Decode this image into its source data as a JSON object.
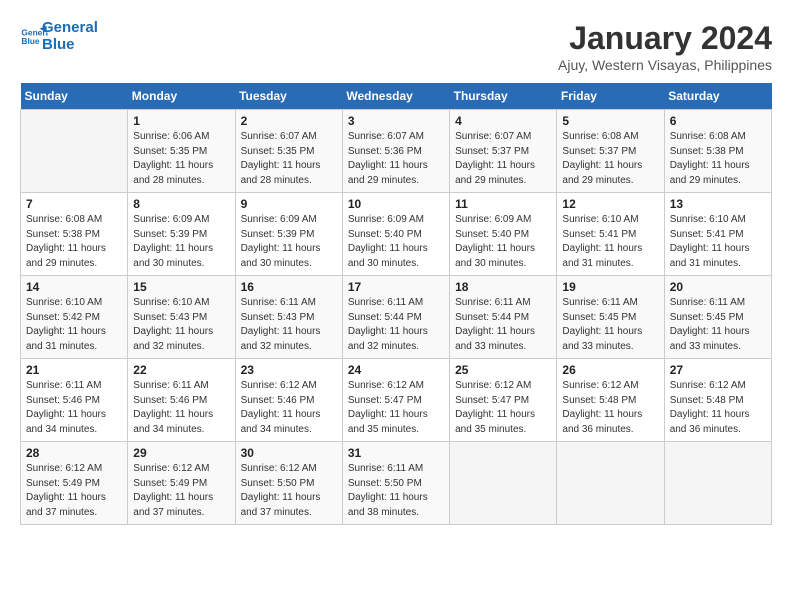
{
  "logo": {
    "line1": "General",
    "line2": "Blue"
  },
  "title": "January 2024",
  "subtitle": "Ajuy, Western Visayas, Philippines",
  "days_header": [
    "Sunday",
    "Monday",
    "Tuesday",
    "Wednesday",
    "Thursday",
    "Friday",
    "Saturday"
  ],
  "weeks": [
    [
      {
        "num": "",
        "info": ""
      },
      {
        "num": "1",
        "info": "Sunrise: 6:06 AM\nSunset: 5:35 PM\nDaylight: 11 hours\nand 28 minutes."
      },
      {
        "num": "2",
        "info": "Sunrise: 6:07 AM\nSunset: 5:35 PM\nDaylight: 11 hours\nand 28 minutes."
      },
      {
        "num": "3",
        "info": "Sunrise: 6:07 AM\nSunset: 5:36 PM\nDaylight: 11 hours\nand 29 minutes."
      },
      {
        "num": "4",
        "info": "Sunrise: 6:07 AM\nSunset: 5:37 PM\nDaylight: 11 hours\nand 29 minutes."
      },
      {
        "num": "5",
        "info": "Sunrise: 6:08 AM\nSunset: 5:37 PM\nDaylight: 11 hours\nand 29 minutes."
      },
      {
        "num": "6",
        "info": "Sunrise: 6:08 AM\nSunset: 5:38 PM\nDaylight: 11 hours\nand 29 minutes."
      }
    ],
    [
      {
        "num": "7",
        "info": "Sunrise: 6:08 AM\nSunset: 5:38 PM\nDaylight: 11 hours\nand 29 minutes."
      },
      {
        "num": "8",
        "info": "Sunrise: 6:09 AM\nSunset: 5:39 PM\nDaylight: 11 hours\nand 30 minutes."
      },
      {
        "num": "9",
        "info": "Sunrise: 6:09 AM\nSunset: 5:39 PM\nDaylight: 11 hours\nand 30 minutes."
      },
      {
        "num": "10",
        "info": "Sunrise: 6:09 AM\nSunset: 5:40 PM\nDaylight: 11 hours\nand 30 minutes."
      },
      {
        "num": "11",
        "info": "Sunrise: 6:09 AM\nSunset: 5:40 PM\nDaylight: 11 hours\nand 30 minutes."
      },
      {
        "num": "12",
        "info": "Sunrise: 6:10 AM\nSunset: 5:41 PM\nDaylight: 11 hours\nand 31 minutes."
      },
      {
        "num": "13",
        "info": "Sunrise: 6:10 AM\nSunset: 5:41 PM\nDaylight: 11 hours\nand 31 minutes."
      }
    ],
    [
      {
        "num": "14",
        "info": "Sunrise: 6:10 AM\nSunset: 5:42 PM\nDaylight: 11 hours\nand 31 minutes."
      },
      {
        "num": "15",
        "info": "Sunrise: 6:10 AM\nSunset: 5:43 PM\nDaylight: 11 hours\nand 32 minutes."
      },
      {
        "num": "16",
        "info": "Sunrise: 6:11 AM\nSunset: 5:43 PM\nDaylight: 11 hours\nand 32 minutes."
      },
      {
        "num": "17",
        "info": "Sunrise: 6:11 AM\nSunset: 5:44 PM\nDaylight: 11 hours\nand 32 minutes."
      },
      {
        "num": "18",
        "info": "Sunrise: 6:11 AM\nSunset: 5:44 PM\nDaylight: 11 hours\nand 33 minutes."
      },
      {
        "num": "19",
        "info": "Sunrise: 6:11 AM\nSunset: 5:45 PM\nDaylight: 11 hours\nand 33 minutes."
      },
      {
        "num": "20",
        "info": "Sunrise: 6:11 AM\nSunset: 5:45 PM\nDaylight: 11 hours\nand 33 minutes."
      }
    ],
    [
      {
        "num": "21",
        "info": "Sunrise: 6:11 AM\nSunset: 5:46 PM\nDaylight: 11 hours\nand 34 minutes."
      },
      {
        "num": "22",
        "info": "Sunrise: 6:11 AM\nSunset: 5:46 PM\nDaylight: 11 hours\nand 34 minutes."
      },
      {
        "num": "23",
        "info": "Sunrise: 6:12 AM\nSunset: 5:46 PM\nDaylight: 11 hours\nand 34 minutes."
      },
      {
        "num": "24",
        "info": "Sunrise: 6:12 AM\nSunset: 5:47 PM\nDaylight: 11 hours\nand 35 minutes."
      },
      {
        "num": "25",
        "info": "Sunrise: 6:12 AM\nSunset: 5:47 PM\nDaylight: 11 hours\nand 35 minutes."
      },
      {
        "num": "26",
        "info": "Sunrise: 6:12 AM\nSunset: 5:48 PM\nDaylight: 11 hours\nand 36 minutes."
      },
      {
        "num": "27",
        "info": "Sunrise: 6:12 AM\nSunset: 5:48 PM\nDaylight: 11 hours\nand 36 minutes."
      }
    ],
    [
      {
        "num": "28",
        "info": "Sunrise: 6:12 AM\nSunset: 5:49 PM\nDaylight: 11 hours\nand 37 minutes."
      },
      {
        "num": "29",
        "info": "Sunrise: 6:12 AM\nSunset: 5:49 PM\nDaylight: 11 hours\nand 37 minutes."
      },
      {
        "num": "30",
        "info": "Sunrise: 6:12 AM\nSunset: 5:50 PM\nDaylight: 11 hours\nand 37 minutes."
      },
      {
        "num": "31",
        "info": "Sunrise: 6:11 AM\nSunset: 5:50 PM\nDaylight: 11 hours\nand 38 minutes."
      },
      {
        "num": "",
        "info": ""
      },
      {
        "num": "",
        "info": ""
      },
      {
        "num": "",
        "info": ""
      }
    ]
  ]
}
